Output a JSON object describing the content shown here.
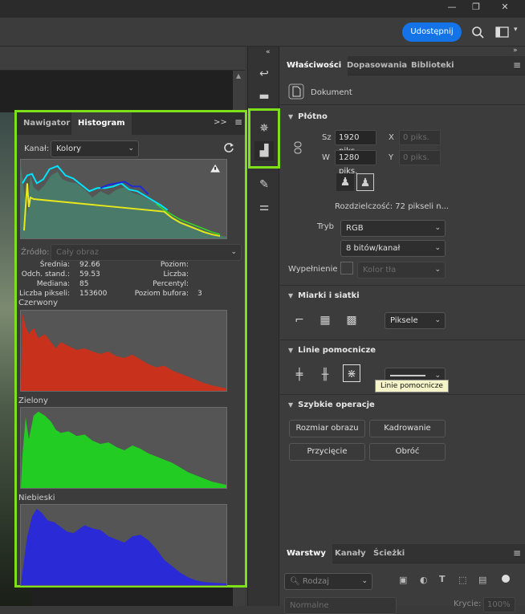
{
  "titlebar": {
    "minimize": "—",
    "restore": "❐",
    "close": "✕"
  },
  "optionsbar": {
    "share_label": "Udostępnij"
  },
  "histogram_panel": {
    "tabs": [
      {
        "label": "Nawigator"
      },
      {
        "label": "Histogram"
      }
    ],
    "expand_icon": ">>",
    "channel_label": "Kanał:",
    "channel_value": "Kolory",
    "source_label": "Źródło:",
    "source_value": "Cały obraz",
    "stats": {
      "mean_label": "Średnia:",
      "mean_value": "92.66",
      "stddev_label": "Odch. stand.:",
      "stddev_value": "59.53",
      "median_label": "Mediana:",
      "median_value": "85",
      "pixels_label": "Liczba pikseli:",
      "pixels_value": "153600",
      "level_label": "Poziom:",
      "count_label": "Liczba:",
      "percentile_label": "Percentyl:",
      "cache_label": "Poziom bufora:",
      "cache_value": "3"
    },
    "channels": [
      {
        "name": "Czerwony",
        "color": "#c8321c"
      },
      {
        "name": "Zielony",
        "color": "#22cc22"
      },
      {
        "name": "Niebieski",
        "color": "#2a2ad6"
      }
    ]
  },
  "properties": {
    "tabs": [
      {
        "label": "Właściwości"
      },
      {
        "label": "Dopasowania"
      },
      {
        "label": "Biblioteki"
      }
    ],
    "document_label": "Dokument",
    "canvas": {
      "title": "Płótno",
      "width_label": "Sz",
      "width_value": "1920 piks.",
      "height_label": "W",
      "height_value": "1280 piks.",
      "x_label": "X",
      "x_placeholder": "0 piks.",
      "y_label": "Y",
      "y_placeholder": "0 piks.",
      "resolution_text": "Rozdzielczość:  72 pikseli n...",
      "mode_label": "Tryb",
      "mode_value": "RGB",
      "depth_value": "8 bitów/kanał",
      "fill_label": "Wypełnienie",
      "fill_value": "Kolor tła"
    },
    "rulers": {
      "title": "Miarki i siatki",
      "unit_value": "Piksele"
    },
    "guides": {
      "title": "Linie pomocnicze",
      "tooltip": "Linie pomocnicze"
    },
    "quick_actions": {
      "title": "Szybkie operacje",
      "buttons": [
        "Rozmiar obrazu",
        "Kadrowanie",
        "Przycięcie",
        "Obróć"
      ]
    }
  },
  "layers_panel": {
    "tabs": [
      {
        "label": "Warstwy"
      },
      {
        "label": "Kanały"
      },
      {
        "label": "Ścieżki"
      }
    ],
    "filter_value": "Rodzaj",
    "blend_value": "Normalne",
    "opacity_label": "Krycie:",
    "opacity_value": "100%"
  },
  "colors": {
    "highlight": "#7ee01a",
    "accent": "#1473e6"
  }
}
